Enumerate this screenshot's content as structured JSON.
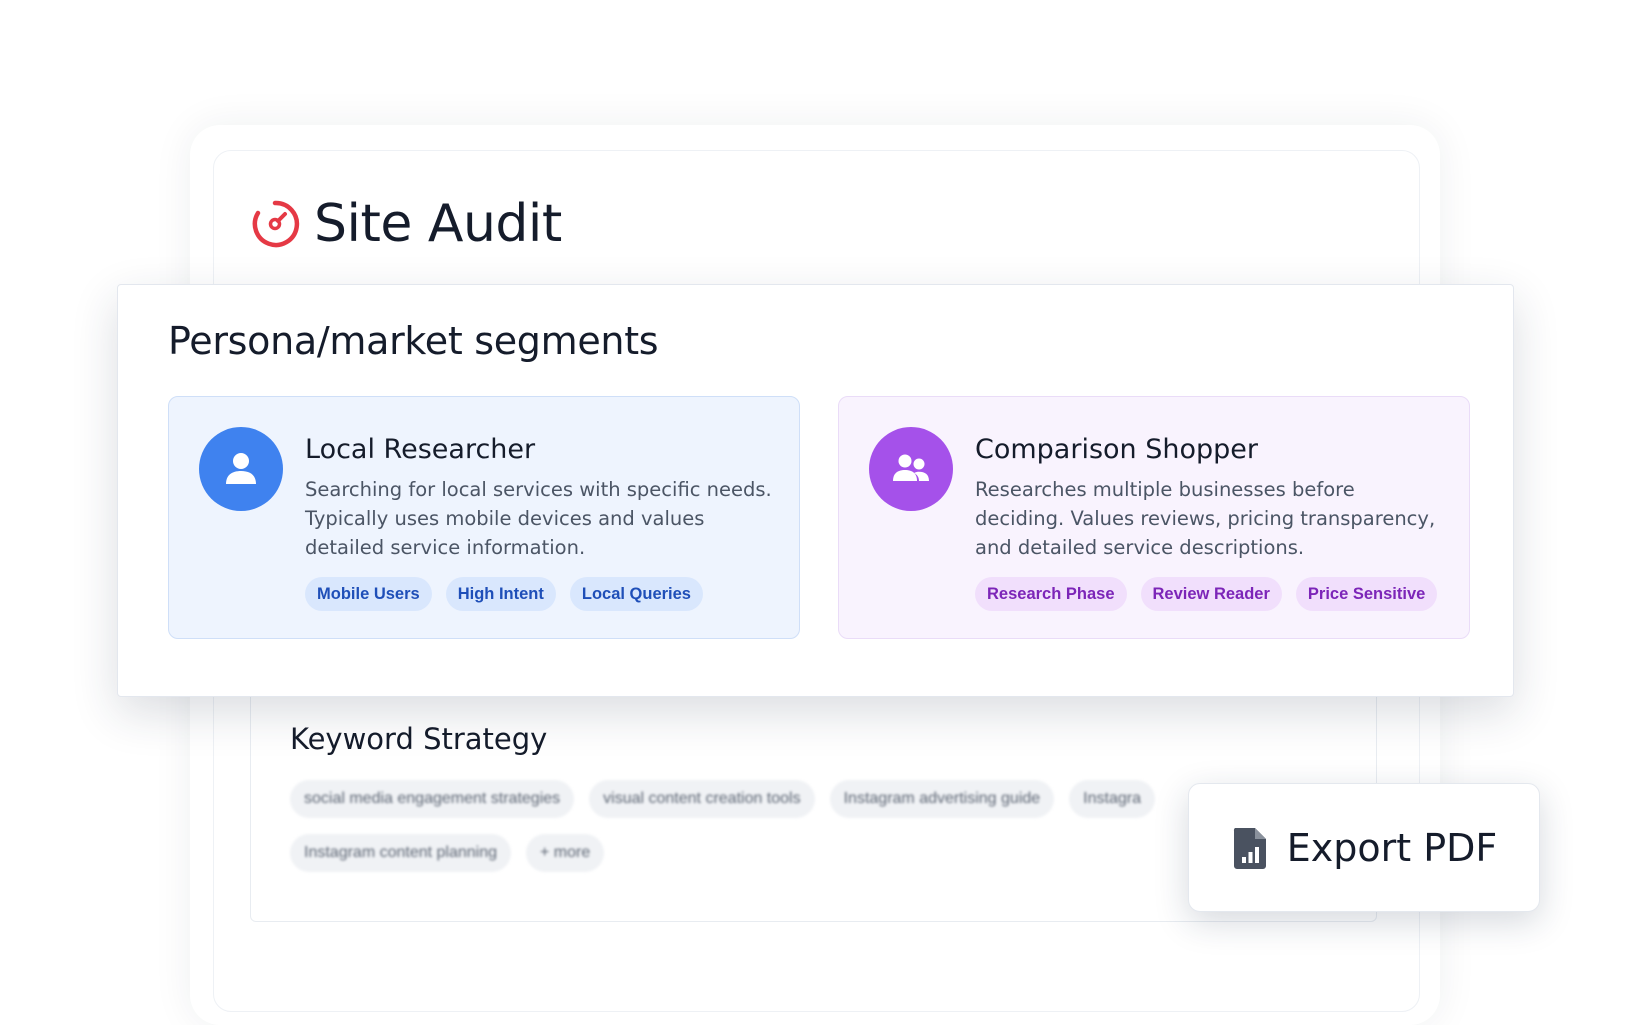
{
  "site_audit": {
    "title": "Site Audit",
    "icon": "gauge-icon",
    "icon_color": "#e53945"
  },
  "persona_panel": {
    "heading": "Persona/market segments",
    "segments": [
      {
        "title": "Local Researcher",
        "description": "Searching for local services with specific needs. Typically uses mobile devices and values detailed service information.",
        "icon": "user-icon",
        "accent": "#3f82ef",
        "tags": [
          "Mobile Users",
          "High Intent",
          "Local Queries"
        ]
      },
      {
        "title": "Comparison Shopper",
        "description": "Researches multiple businesses before deciding. Values reviews, pricing transparency, and detailed service descriptions.",
        "icon": "users-icon",
        "accent": "#a551ea",
        "tags": [
          "Research Phase",
          "Review Reader",
          "Price Sensitive"
        ]
      }
    ]
  },
  "keyword_strategy": {
    "title": "Keyword Strategy",
    "chips": [
      "social media engagement strategies",
      "visual content creation tools",
      "Instagram advertising guide",
      "Instagra",
      "Instagram content planning",
      "+ more"
    ]
  },
  "export": {
    "label": "Export PDF",
    "icon": "file-chart-icon"
  }
}
